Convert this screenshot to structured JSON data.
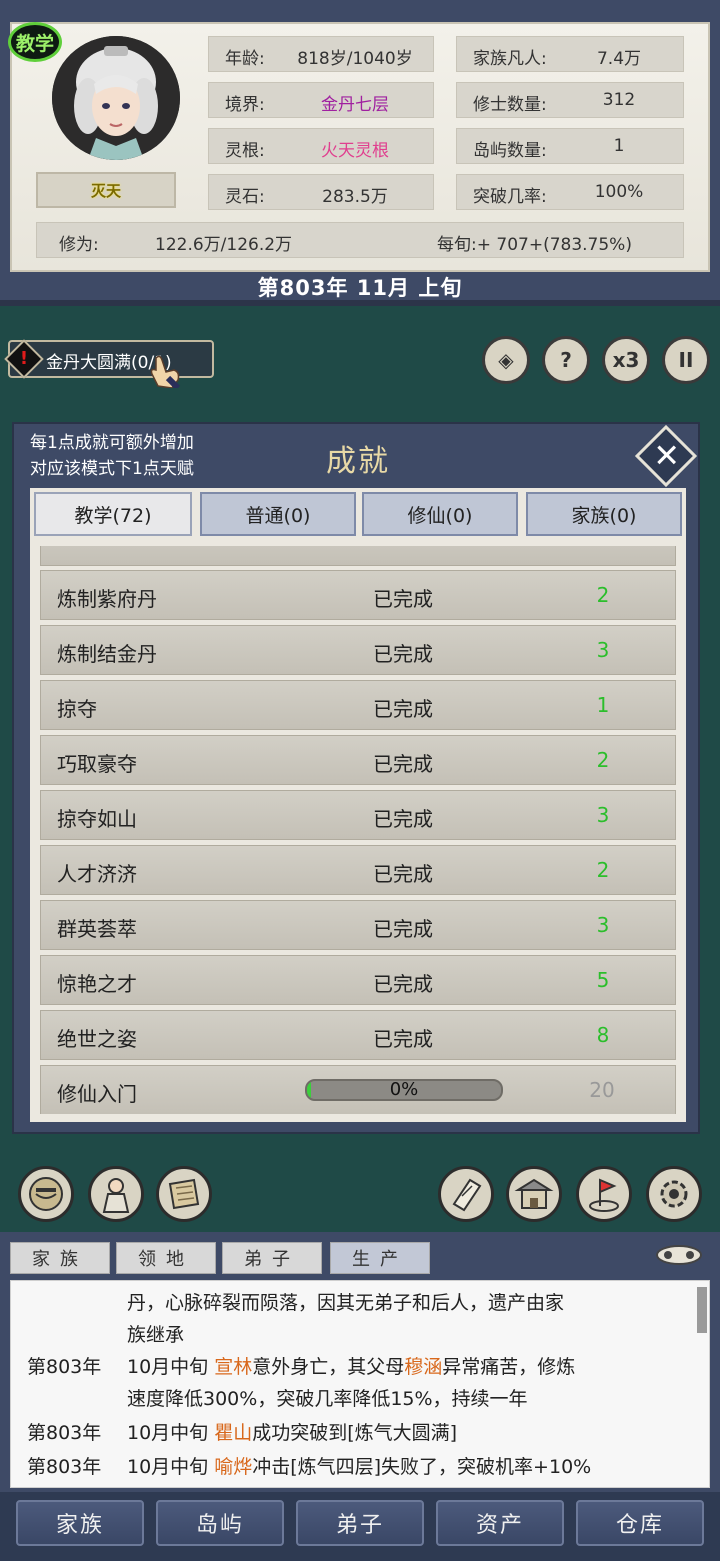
{
  "header": {
    "mode_badge": "教学",
    "player_name": "灭天",
    "stats_left": [
      {
        "label": "年龄:",
        "value": "818岁/1040岁",
        "color": "#333333"
      },
      {
        "label": "境界:",
        "value": "金丹七层",
        "color": "#a020a0"
      },
      {
        "label": "灵根:",
        "value": "火天灵根",
        "color": "#e0408f"
      },
      {
        "label": "灵石:",
        "value": "283.5万",
        "color": "#333333"
      }
    ],
    "stats_right": [
      {
        "label": "家族凡人:",
        "value": "7.4万"
      },
      {
        "label": "修士数量:",
        "value": "312"
      },
      {
        "label": "岛屿数量:",
        "value": "1"
      },
      {
        "label": "突破几率:",
        "value": "100%"
      }
    ],
    "cultivation_label": "修为:",
    "cultivation_value": "122.6万/126.2万",
    "per_turn": "每旬:+ 707+(783.75%)",
    "date": "第803年 11月 上旬"
  },
  "quest": {
    "alert_icon": "!",
    "label": "金丹大圆满(0/1)"
  },
  "top_icons": [
    {
      "name": "clan-crest-icon",
      "glyph": "◈"
    },
    {
      "name": "help-icon",
      "glyph": "?"
    },
    {
      "name": "speed-x3-icon",
      "glyph": "x3"
    },
    {
      "name": "pause-icon",
      "glyph": "II"
    }
  ],
  "modal": {
    "hint_line1": "每1点成就可额外增加",
    "hint_line2": "对应该模式下1点天赋",
    "title": "成就",
    "close_icon": "✕",
    "tabs": [
      {
        "label": "教学(72)",
        "active": true
      },
      {
        "label": "普通(0)",
        "active": false
      },
      {
        "label": "修仙(0)",
        "active": false
      },
      {
        "label": "家族(0)",
        "active": false
      }
    ],
    "achievements": [
      {
        "name": "炼制紫府丹",
        "status": "已完成",
        "points": "2"
      },
      {
        "name": "炼制结金丹",
        "status": "已完成",
        "points": "3"
      },
      {
        "name": "掠夺",
        "status": "已完成",
        "points": "1"
      },
      {
        "name": "巧取豪夺",
        "status": "已完成",
        "points": "2"
      },
      {
        "name": "掠夺如山",
        "status": "已完成",
        "points": "3"
      },
      {
        "name": "人才济济",
        "status": "已完成",
        "points": "2"
      },
      {
        "name": "群英荟萃",
        "status": "已完成",
        "points": "3"
      },
      {
        "name": "惊艳之才",
        "status": "已完成",
        "points": "5"
      },
      {
        "name": "绝世之姿",
        "status": "已完成",
        "points": "8"
      }
    ],
    "in_progress": {
      "name": "修仙入门",
      "progress_label": "0%",
      "progress": 0.02,
      "points": "20"
    }
  },
  "action_icons": [
    "face-icon",
    "disciple-icon",
    "scroll-icon",
    "ticket-icon",
    "temple-icon",
    "map-flag-icon",
    "settings-gear-icon"
  ],
  "log": {
    "tabs": [
      {
        "label": "家族",
        "active": false
      },
      {
        "label": "领地",
        "active": false
      },
      {
        "label": "弟子",
        "active": false
      },
      {
        "label": "生产",
        "active": true
      }
    ],
    "lines": [
      {
        "year": "",
        "pre": "丹，心脉碎裂而陨落，因其无弟子和后人，遗产由家",
        "hl": "",
        "post": ""
      },
      {
        "year": "",
        "pre": "族继承",
        "hl": "",
        "post": ""
      },
      {
        "year": "第803年",
        "pre": "10月中旬 ",
        "hl": "宣林",
        "post": "意外身亡，其父母"
      },
      {
        "year": "",
        "pre": "速度降低300%，突破几率降低15%，持续一年",
        "hl": "",
        "post": ""
      },
      {
        "year": "第803年",
        "pre": "10月中旬 ",
        "hl": "瞿山",
        "post": "成功突破到[炼气大圆满]"
      },
      {
        "year": "第803年",
        "pre": "10月中旬 ",
        "hl": "喻烨",
        "post": "冲击[炼气四层]失败了，突破机率+10%"
      }
    ],
    "line3_hl2": "穆涵",
    "line3_tail": "异常痛苦，修炼"
  },
  "bottom_nav": [
    "家族",
    "岛屿",
    "弟子",
    "资产",
    "仓库"
  ]
}
